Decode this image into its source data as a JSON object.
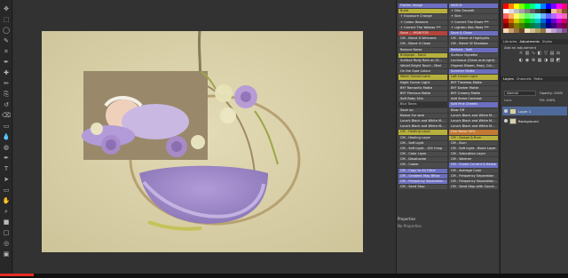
{
  "toolbar": {
    "tools": [
      "move-tool",
      "marquee-tool",
      "lasso-tool",
      "quick-select-tool",
      "crop-tool",
      "eyedropper-tool",
      "healing-tool",
      "brush-tool",
      "clone-stamp-tool",
      "history-brush-tool",
      "eraser-tool",
      "gradient-tool",
      "blur-tool",
      "dodge-tool",
      "pen-tool",
      "type-tool",
      "path-select-tool",
      "shape-tool",
      "hand-tool",
      "zoom-tool",
      "foreground-color",
      "background-color",
      "quick-mask",
      "screen-mode"
    ]
  },
  "actions": {
    "items": [
      {
        "label": "Flatten Image",
        "color": "purple"
      },
      {
        "label": "MATCH",
        "color": "purple"
      },
      {
        "label": "Build",
        "color": "yellow"
      },
      {
        "label": "+ Dim Smooth",
        "color": "gray"
      },
      {
        "label": "+ Exposure Change",
        "color": "gray"
      },
      {
        "label": "+ Skin",
        "color": "gray"
      },
      {
        "label": "+ Colour Balance",
        "color": "gray"
      },
      {
        "label": "+ Correct The Blues ***",
        "color": "gray"
      },
      {
        "label": "+ Correct The Yellows ***",
        "color": "gray"
      },
      {
        "label": "+ Lighten Skin Reds ***",
        "color": "gray"
      },
      {
        "label": "Save ... MONITOR",
        "color": "red"
      },
      {
        "label": "Save & Close",
        "color": "purple"
      },
      {
        "label": "CM - Blend It Welcome",
        "color": "gray"
      },
      {
        "label": "CM - Blend of Highlights",
        "color": "gray"
      },
      {
        "label": "CM - Blend it Clean",
        "color": "gray"
      },
      {
        "label": "CM - Blend Of Shadows",
        "color": "gray"
      },
      {
        "label": "Reduce Noise",
        "color": "gray"
      },
      {
        "label": "Reduce - Soft",
        "color": "purple"
      },
      {
        "label": "Bridgepe - Sand",
        "color": "yellow"
      },
      {
        "label": "Surface Vignette",
        "color": "gray"
      },
      {
        "label": "Surface Rudy Rain on Gl...",
        "color": "gray"
      },
      {
        "label": "Luminous (Clean and Light)",
        "color": "gray"
      },
      {
        "label": "Velvet Bright Touch - Med",
        "color": "gray"
      },
      {
        "label": "Organic Bloom, Hazy, Col...",
        "color": "gray"
      },
      {
        "label": "On the Spot Colour",
        "color": "gray"
      },
      {
        "label": "Summer Matte",
        "color": "purple"
      },
      {
        "label": "Warm Sunset Lane",
        "color": "yellow"
      },
      {
        "label": "Loft Corner Light",
        "color": "yellow"
      },
      {
        "label": "Night Corner Light",
        "color": "gray"
      },
      {
        "label": "BYF Timeless Matte",
        "color": "gray"
      },
      {
        "label": "BYF Romantic Matte",
        "color": "gray"
      },
      {
        "label": "BYF Darker Matte",
        "color": "gray"
      },
      {
        "label": "BYF Precious Matte",
        "color": "gray"
      },
      {
        "label": "BYF Creamy Matte",
        "color": "gray"
      },
      {
        "label": "Soft Baby Skin",
        "color": "gray"
      },
      {
        "label": "Add Some Contrast",
        "color": "gray"
      },
      {
        "label": "Blur Tones",
        "color": "none"
      },
      {
        "label": "Soft Pink Cheeks",
        "color": "purple"
      },
      {
        "label": "Save up",
        "color": "gray"
      },
      {
        "label": "Blow Off",
        "color": "gray"
      },
      {
        "label": "Resize For web",
        "color": "gray"
      },
      {
        "label": "Luna's Black and White M...",
        "color": "gray"
      },
      {
        "label": "Luna's Black and White M...",
        "color": "gray"
      },
      {
        "label": "Luna's Black and White M...",
        "color": "gray"
      },
      {
        "label": "Luna's Black and White M...",
        "color": "gray"
      },
      {
        "label": "Luna's Black and White M...",
        "color": "gray"
      },
      {
        "label": "CM - Healing Layer",
        "color": "yellow"
      },
      {
        "label": "Dim Noise 90%",
        "color": "orange"
      },
      {
        "label": "CM - Healing Layer",
        "color": "gray"
      },
      {
        "label": "CM - Dodge & Burn",
        "color": "yellow"
      },
      {
        "label": "CM - Soft Light",
        "color": "gray"
      },
      {
        "label": "CM - Burn",
        "color": "gray"
      },
      {
        "label": "CM - Soft Light - 100 Crisp",
        "color": "gray"
      },
      {
        "label": "CM - Soft Light - Black Layer",
        "color": "gray"
      },
      {
        "label": "CM - Color Layer",
        "color": "gray"
      },
      {
        "label": "CM - Saturation Layer",
        "color": "gray"
      },
      {
        "label": "CM - Desaturate",
        "color": "gray"
      },
      {
        "label": "CM - Warmer",
        "color": "gray"
      },
      {
        "label": "CM - Cooler",
        "color": "gray"
      },
      {
        "label": "CM - Frame Current & Below",
        "color": "purple"
      },
      {
        "label": "CM - Copy to All Other",
        "color": "purple"
      },
      {
        "label": "CM - Average Color",
        "color": "gray"
      },
      {
        "label": "CM - Gradient Map Bflow",
        "color": "purple"
      },
      {
        "label": "CM - Frequency Separation",
        "color": "gray"
      },
      {
        "label": "CM - Frequency Separation...",
        "color": "purple"
      },
      {
        "label": "CM - Frequency Separation...",
        "color": "gray"
      },
      {
        "label": "CM - Send Stop",
        "color": "gray"
      },
      {
        "label": "CM - Send Stop with Count...",
        "color": "gray"
      }
    ],
    "panel_title": "Properties",
    "panel_text": "No Properties"
  },
  "right_panel": {
    "top_tabs": [
      "Libraries",
      "Adjustments",
      "Styles"
    ],
    "adjustments_title": "Add an adjustment",
    "layer_tabs": [
      "Layers",
      "Channels",
      "Paths"
    ],
    "blend_mode": "Normal",
    "opacity_label": "Opacity: 100%",
    "fill_label": "Fill: 100%",
    "lock_label": "Lock:",
    "layers": [
      {
        "name": "Layer 1",
        "selected": true
      },
      {
        "name": "Background",
        "selected": false
      }
    ],
    "swatch_colors": [
      "#ff0000",
      "#ff8000",
      "#ffff00",
      "#80ff00",
      "#00ff00",
      "#00ff80",
      "#00ffff",
      "#0080ff",
      "#0000ff",
      "#8000ff",
      "#ff00ff",
      "#ff0080",
      "#ffffff",
      "#e0e0e0",
      "#c0c0c0",
      "#a0a0a0",
      "#808080",
      "#606060",
      "#404040",
      "#202020",
      "#000000",
      "#f4c29a",
      "#d49060",
      "#8a5030",
      "#ff6666",
      "#ffb366",
      "#ffff66",
      "#b3ff66",
      "#66ff66",
      "#66ffb3",
      "#66ffff",
      "#66b3ff",
      "#6666ff",
      "#b366ff",
      "#ff66ff",
      "#ff66b3",
      "#cc0000",
      "#cc6600",
      "#cccc00",
      "#66cc00",
      "#00cc00",
      "#00cc66",
      "#00cccc",
      "#0066cc",
      "#0000cc",
      "#6600cc",
      "#cc00cc",
      "#cc0066",
      "#800000",
      "#804000",
      "#808000",
      "#408000",
      "#008000",
      "#008040",
      "#008080",
      "#004080",
      "#000080",
      "#400080",
      "#800080",
      "#800040",
      "#ffd8b0",
      "#c8a070",
      "#987040",
      "#684820",
      "#f0e0c0",
      "#d0c090",
      "#b0a060",
      "#907840",
      "#e0c8e0",
      "#c0a0d0",
      "#a080c0",
      "#805090"
    ]
  },
  "progress": {
    "percent": 6
  }
}
